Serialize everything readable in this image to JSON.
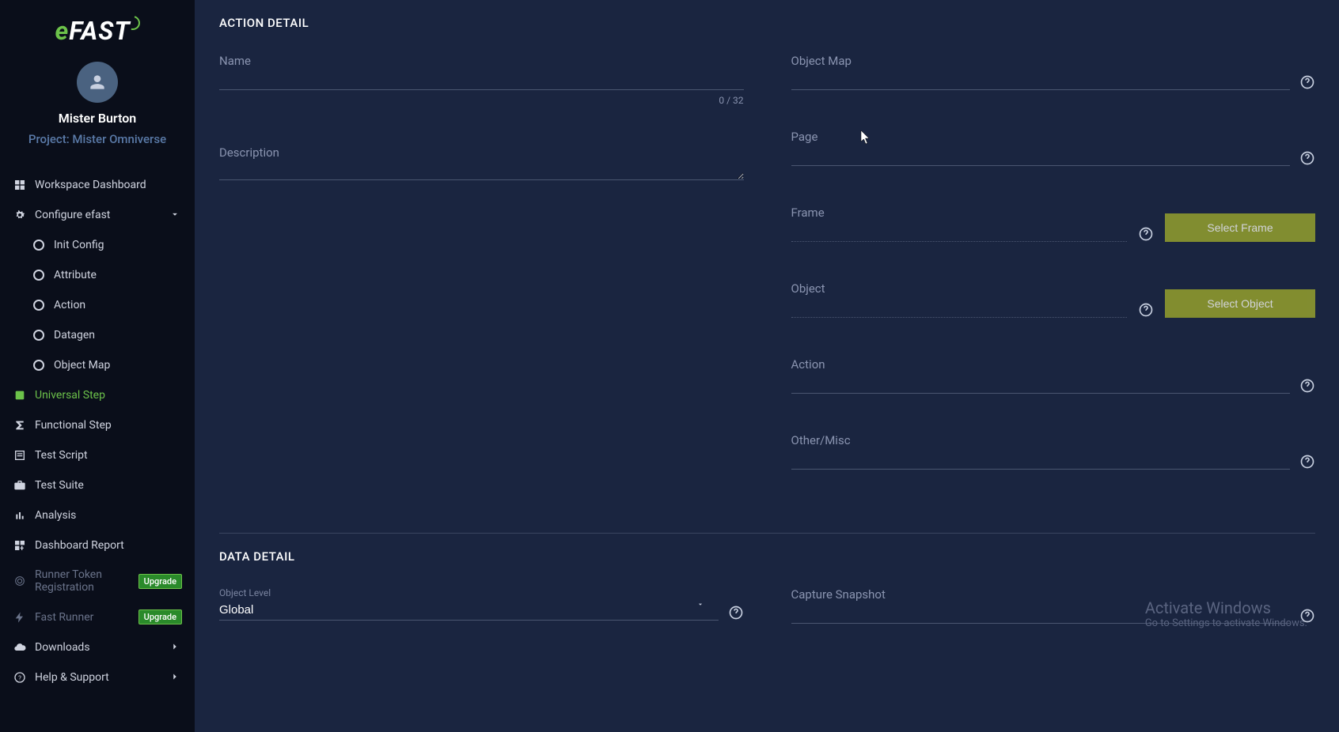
{
  "brand": {
    "name": "eFAST"
  },
  "user": {
    "name": "Mister Burton",
    "project": "Project: Mister Omniverse"
  },
  "sidebar": {
    "workspace": "Workspace Dashboard",
    "configure": "Configure efast",
    "sub": {
      "init": "Init Config",
      "attribute": "Attribute",
      "action": "Action",
      "datagen": "Datagen",
      "objectmap": "Object Map"
    },
    "universal": "Universal Step",
    "functional": "Functional Step",
    "testscript": "Test Script",
    "testsuite": "Test Suite",
    "analysis": "Analysis",
    "dashboardreport": "Dashboard Report",
    "runnertoken": "Runner Token Registration",
    "fastrunner": "Fast Runner",
    "downloads": "Downloads",
    "help": "Help & Support",
    "upgrade": "Upgrade"
  },
  "action_detail": {
    "title": "ACTION DETAIL",
    "name_label": "Name",
    "name_counter": "0 / 32",
    "description_label": "Description",
    "objectmap_label": "Object Map",
    "page_label": "Page",
    "frame_label": "Frame",
    "select_frame_btn": "Select Frame",
    "object_label": "Object",
    "select_object_btn": "Select Object",
    "action_label": "Action",
    "othermisc_label": "Other/Misc"
  },
  "data_detail": {
    "title": "DATA DETAIL",
    "object_level_label": "Object Level",
    "object_level_value": "Global",
    "capture_snapshot_label": "Capture Snapshot"
  },
  "watermark": {
    "line1": "Activate Windows",
    "line2": "Go to Settings to activate Windows."
  }
}
